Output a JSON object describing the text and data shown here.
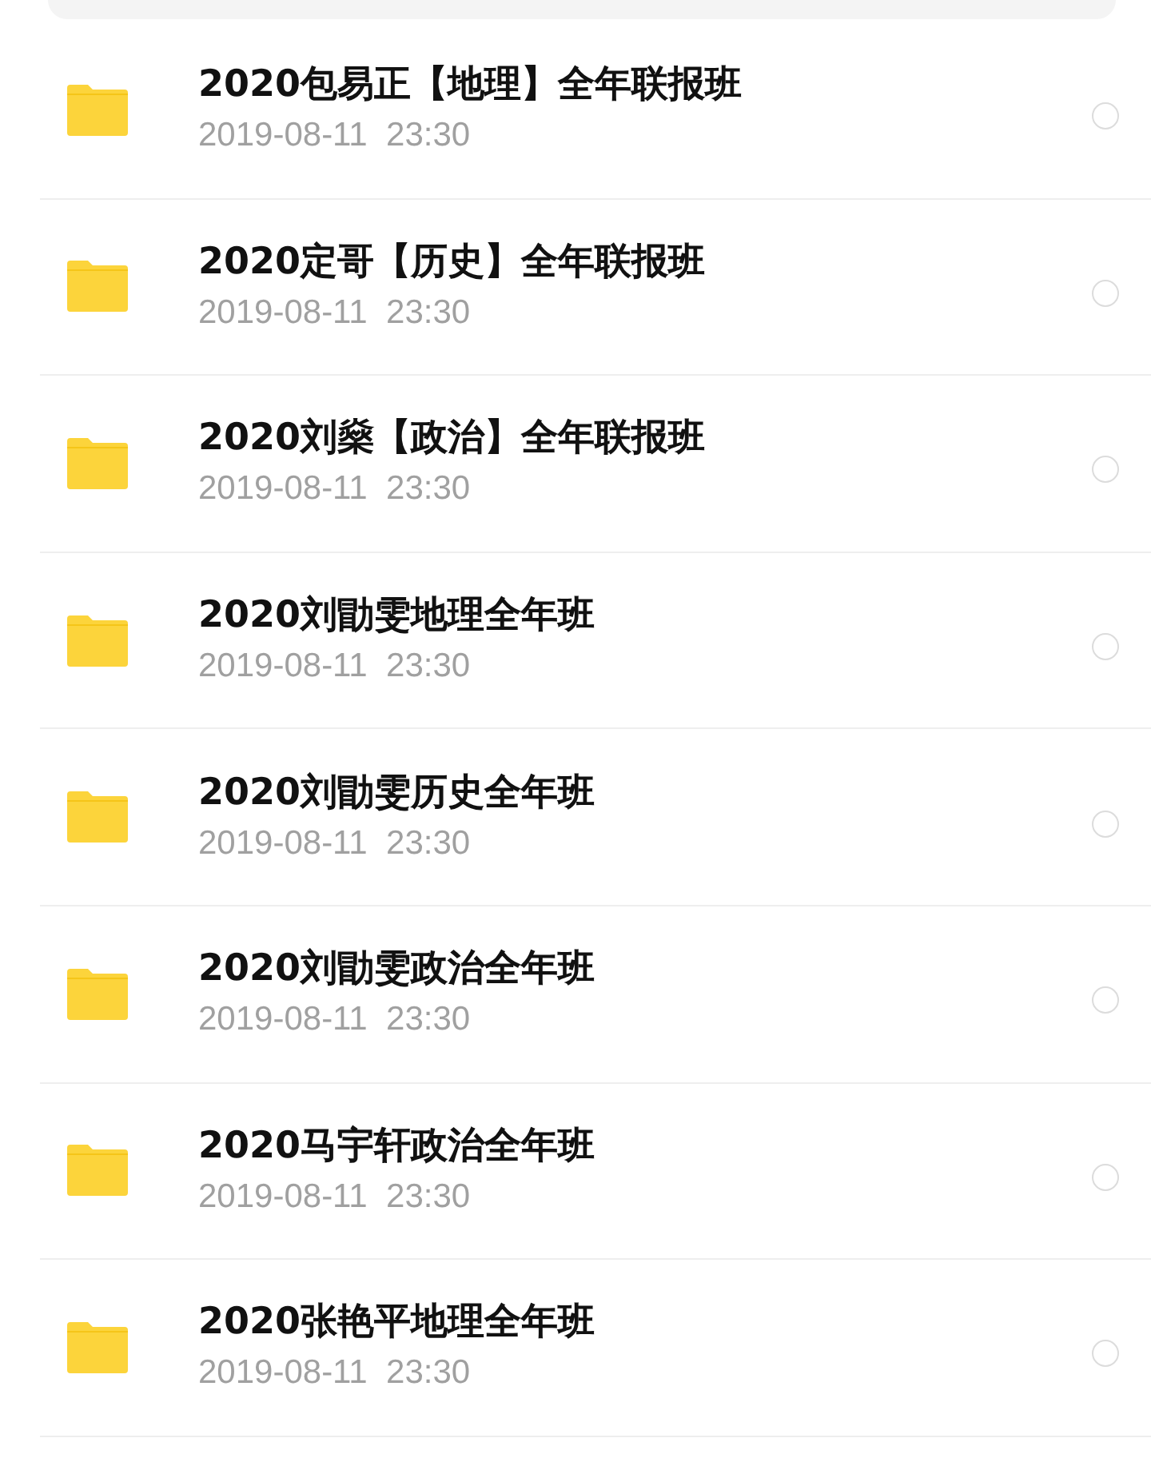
{
  "files": [
    {
      "name": "2020包易正【地理】全年联报班",
      "modified": "2019-08-11  23:30",
      "selected": false
    },
    {
      "name": "2020定哥【历史】全年联报班",
      "modified": "2019-08-11  23:30",
      "selected": false
    },
    {
      "name": "2020刘燊【政治】全年联报班",
      "modified": "2019-08-11  23:30",
      "selected": false
    },
    {
      "name": "2020刘勖雯地理全年班",
      "modified": "2019-08-11  23:30",
      "selected": false
    },
    {
      "name": "2020刘勖雯历史全年班",
      "modified": "2019-08-11  23:30",
      "selected": false
    },
    {
      "name": "2020刘勖雯政治全年班",
      "modified": "2019-08-11  23:30",
      "selected": false
    },
    {
      "name": "2020马宇轩政治全年班",
      "modified": "2019-08-11  23:30",
      "selected": false
    },
    {
      "name": "2020张艳平地理全年班",
      "modified": "2019-08-11  23:30",
      "selected": false
    }
  ]
}
